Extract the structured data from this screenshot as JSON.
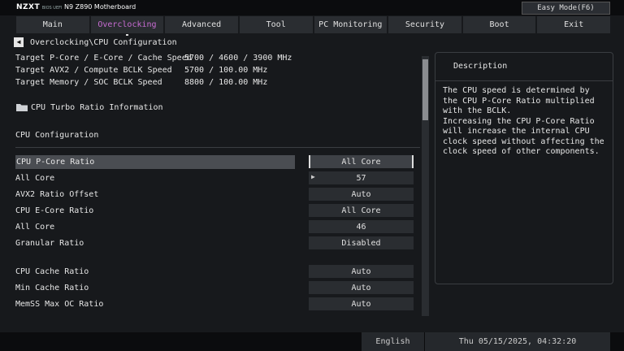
{
  "header": {
    "brand": "NZXT",
    "bios_tag": "BIOS UEFI",
    "board": "N9 Z890 Motherboard",
    "easy_mode": "Easy Mode(F6)"
  },
  "tabs": [
    {
      "label": "Main"
    },
    {
      "label": "Overclocking"
    },
    {
      "label": "Advanced"
    },
    {
      "label": "Tool"
    },
    {
      "label": "PC Monitoring"
    },
    {
      "label": "Security"
    },
    {
      "label": "Boot"
    },
    {
      "label": "Exit"
    }
  ],
  "breadcrumb": {
    "back_icon": "arrow-left-icon",
    "path": "Overclocking\\CPU Configuration"
  },
  "info": [
    {
      "label": "Target P-Core / E-Core / Cache Speed",
      "value": "5700 / 4600 / 3900 MHz"
    },
    {
      "label": "Target AVX2 / Compute BCLK Speed",
      "value": "5700 / 100.00 MHz"
    },
    {
      "label": "Target Memory / SOC BCLK Speed",
      "value": "8800 / 100.00 MHz"
    }
  ],
  "turbo_link": "CPU Turbo Ratio Information",
  "section_title": "CPU Configuration",
  "settings": [
    {
      "label": "CPU P-Core Ratio",
      "value": "All Core"
    },
    {
      "label": " All Core",
      "value": "57"
    },
    {
      "label": "AVX2 Ratio Offset",
      "value": "Auto"
    },
    {
      "label": "CPU E-Core Ratio",
      "value": "All Core"
    },
    {
      "label": " All Core",
      "value": "46"
    },
    {
      "label": "Granular Ratio",
      "value": "Disabled"
    },
    {
      "label": "CPU Cache  Ratio",
      "value": "Auto"
    },
    {
      "label": "Min Cache  Ratio",
      "value": "Auto"
    },
    {
      "label": "MemSS Max OC Ratio",
      "value": "Auto"
    }
  ],
  "description": {
    "title": "Description",
    "text": "The CPU speed is determined by the CPU P-Core Ratio multiplied with the BCLK.\nIncreasing the CPU P-Core Ratio will increase the internal CPU clock speed without affecting the clock speed of other components."
  },
  "footer": {
    "language": "English",
    "datetime": "Thu 05/15/2025, 04:32:20"
  }
}
